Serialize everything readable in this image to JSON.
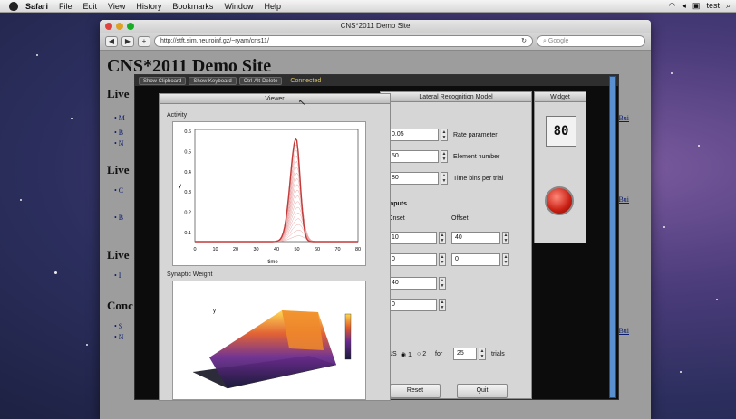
{
  "menubar": {
    "items": [
      "Safari",
      "File",
      "Edit",
      "View",
      "History",
      "Bookmarks",
      "Window",
      "Help"
    ],
    "right_text": "test"
  },
  "browser": {
    "window_title": "CNS*2011 Demo Site",
    "url": "http://stft.sim.neuroinf.gz/~ryam/cns11/",
    "search_placeholder": "Google",
    "back_label": "◀",
    "forward_label": "▶",
    "add_label": "+"
  },
  "page": {
    "title": "CNS*2011 Demo Site",
    "sections": [
      "Live",
      "Live",
      "Live",
      "Conc"
    ],
    "right_link": "Bui"
  },
  "java": {
    "toolbar_buttons": [
      "Show Clipboard",
      "Show Keyboard",
      "Ctrl-Alt-Delete"
    ],
    "status": "Connected",
    "viewer_title": "Viewer",
    "activity_label": "Activity",
    "weight_label": "Synaptic Weight",
    "params_title": "Lateral Recognition Model",
    "widget_title": "Widget",
    "digital_display": "80",
    "plot": {
      "y_axis_label": "y",
      "x_axis_label": "time",
      "x_ticks": [
        "0",
        "10",
        "20",
        "30",
        "40",
        "50",
        "60",
        "70",
        "80"
      ],
      "y_ticks": [
        "0.6",
        "0.5",
        "0.4",
        "0.3",
        "0.2",
        "0.1"
      ]
    },
    "params": {
      "rate_value": "0.05",
      "rate_label": "Rate parameter",
      "element_value": "50",
      "element_label": "Element number",
      "bins_value": "80",
      "bins_label": "Time bins per trial",
      "inputs_header": "Inputs",
      "onset_header": "Onset",
      "offset_header": "Offset",
      "onset1": "10",
      "offset1": "40",
      "onset2": "0",
      "offset2": "0",
      "extra1": "40",
      "extra2": "0",
      "trial_prefix": "US",
      "opt1": "1",
      "opt2": "2",
      "for_label": "for",
      "trials_value": "25",
      "trials_label": "trials",
      "reset_label": "Reset",
      "quit_label": "Quit"
    }
  }
}
